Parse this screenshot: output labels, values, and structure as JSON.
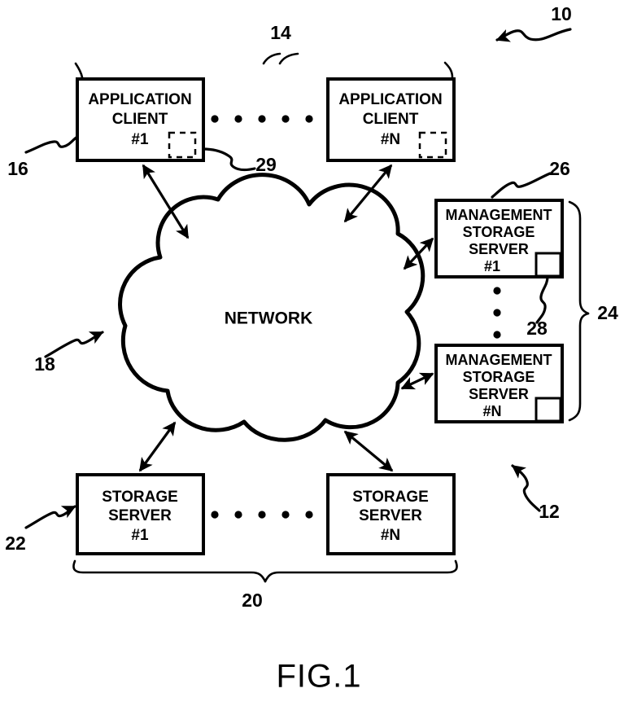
{
  "figure": {
    "caption": "FIG.1",
    "overall_ref": "10"
  },
  "nodes": {
    "application_client_1": {
      "line1": "APPLICATION",
      "line2": "CLIENT",
      "line3": "#1"
    },
    "application_client_n": {
      "line1": "APPLICATION",
      "line2": "CLIENT",
      "line3": "#N"
    },
    "management_storage_server_1": {
      "line1": "MANAGEMENT",
      "line2": "STORAGE",
      "line3": "SERVER",
      "line4": "#1"
    },
    "management_storage_server_n": {
      "line1": "MANAGEMENT",
      "line2": "STORAGE",
      "line3": "SERVER",
      "line4": "#N"
    },
    "storage_server_1": {
      "line1": "STORAGE",
      "line2": "SERVER",
      "line3": "#1"
    },
    "storage_server_n": {
      "line1": "STORAGE",
      "line2": "SERVER",
      "line3": "#N"
    },
    "network_cloud": {
      "label": "NETWORK"
    }
  },
  "reference_numerals": {
    "system": "10",
    "storage_system": "12",
    "client_group": "14",
    "client_lead": "16",
    "network": "18",
    "storage_server_group": "20",
    "storage_server_lead": "22",
    "mgmt_server_group": "24",
    "mgmt_server_lead": "26",
    "mgmt_agent": "28",
    "client_agent": "29"
  },
  "colors": {
    "ink": "#000000",
    "paper": "#ffffff"
  }
}
